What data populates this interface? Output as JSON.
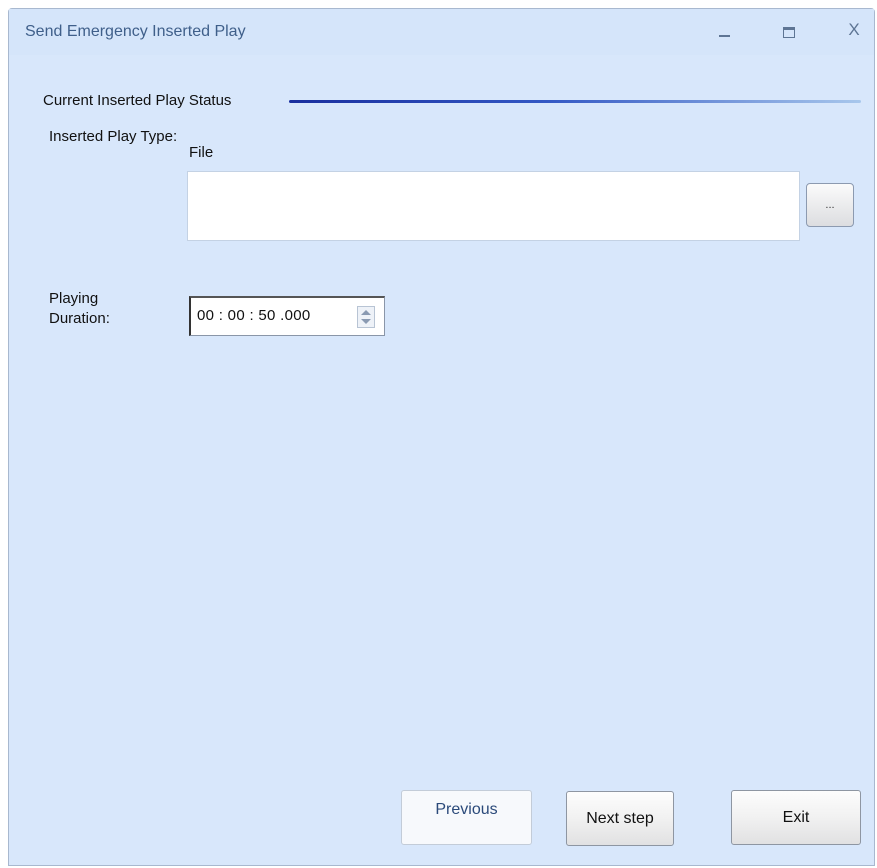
{
  "window": {
    "title": "Send Emergency Inserted Play",
    "minimize_label": "",
    "maximize_label": "",
    "close_label": "X"
  },
  "status_group": {
    "title": "Current Inserted Play Status"
  },
  "inserted_play_type": {
    "label": "Inserted Play Type:",
    "value": "File",
    "file_path": "",
    "browse_label": "..."
  },
  "playing_duration": {
    "label": "Playing Duration:",
    "value": "00 : 00 : 50 .000"
  },
  "buttons": {
    "previous": "Previous",
    "next": "Next step",
    "exit": "Exit"
  }
}
